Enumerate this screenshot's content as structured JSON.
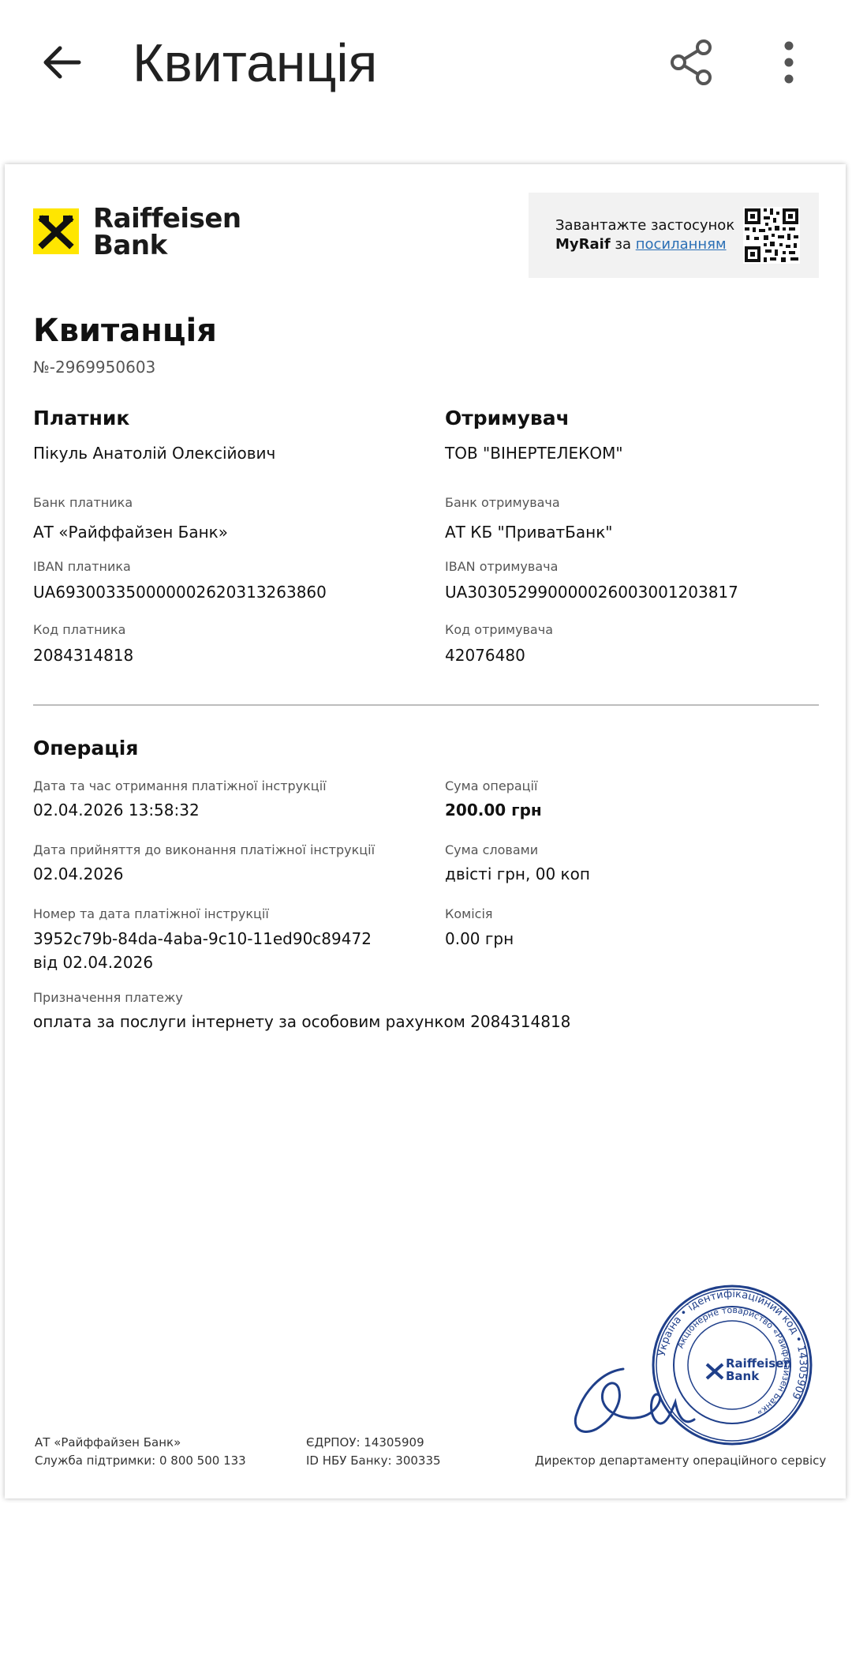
{
  "appbar": {
    "title": "Квитанція",
    "back_icon": "arrow-left-icon",
    "share_icon": "share-icon",
    "more_icon": "more-vertical-icon"
  },
  "brand": {
    "name_line1": "Raiffeisen",
    "name_line2": "Bank",
    "accent_color": "#FFE600",
    "stamp_color": "#1f3f8a"
  },
  "promo": {
    "text_prefix": "Завантажте застосунок",
    "app_name": "MyRaif",
    "connector": " за ",
    "link_text": "посиланням"
  },
  "receipt": {
    "title": "Квитанція",
    "number": "№-2969950603"
  },
  "payer": {
    "heading": "Платник",
    "name": "Пікуль Анатолій Олексійович",
    "bank_label": "Банк платника",
    "bank": "АТ «Райффайзен Банк»",
    "iban_label": "IBAN платника",
    "iban": "UA693003350000002620313263860",
    "code_label": "Код платника",
    "code": "2084314818"
  },
  "recipient": {
    "heading": "Отримувач",
    "name": "ТОВ \"ВІНЕРТЕЛЕКОМ\"",
    "bank_label": "Банк отримувача",
    "bank": "АТ КБ \"ПриватБанк\"",
    "iban_label": "IBAN отримувача",
    "iban": "UA303052990000026003001203817",
    "code_label": "Код отримувача",
    "code": "42076480"
  },
  "operation": {
    "heading": "Операція",
    "received_label": "Дата та час отримання платіжної інструкції",
    "received": "02.04.2026 13:58:32",
    "accepted_label": "Дата прийняття до виконання платіжної інструкції",
    "accepted": "02.04.2026",
    "instruction_label": "Номер та дата платіжної інструкції",
    "instruction_id": "3952c79b-84da-4aba-9c10-11ed90c89472",
    "instruction_date": " від 02.04.2026",
    "amount_label": "Сума операції",
    "amount": "200.00 грн",
    "words_label": "Сума словами",
    "words": "двісті грн, 00 коп",
    "fee_label": "Комісія",
    "fee": "0.00 грн",
    "purpose_label": "Призначення платежу",
    "purpose": "оплата за послуги інтернету за особовим рахунком 2084314818"
  },
  "footer": {
    "bank": "АТ «Райффайзен Банк»",
    "support": "Служба підтримки: 0 800 500 133",
    "edrpou": "ЄДРПОУ: 14305909",
    "nbu_id": "ID НБУ Банку: 300335",
    "signatory": "Директор департаменту операційного сервісу"
  },
  "stamp": {
    "ring_top": "Україна",
    "ring_id": "ідентифікаційний код",
    "ring_right": "Акціонерне товариство",
    "ring_bottom": "«Райффайзен Банк»",
    "code": "14305909",
    "logo_line1": "Raiffeisen",
    "logo_line2": "Bank"
  }
}
